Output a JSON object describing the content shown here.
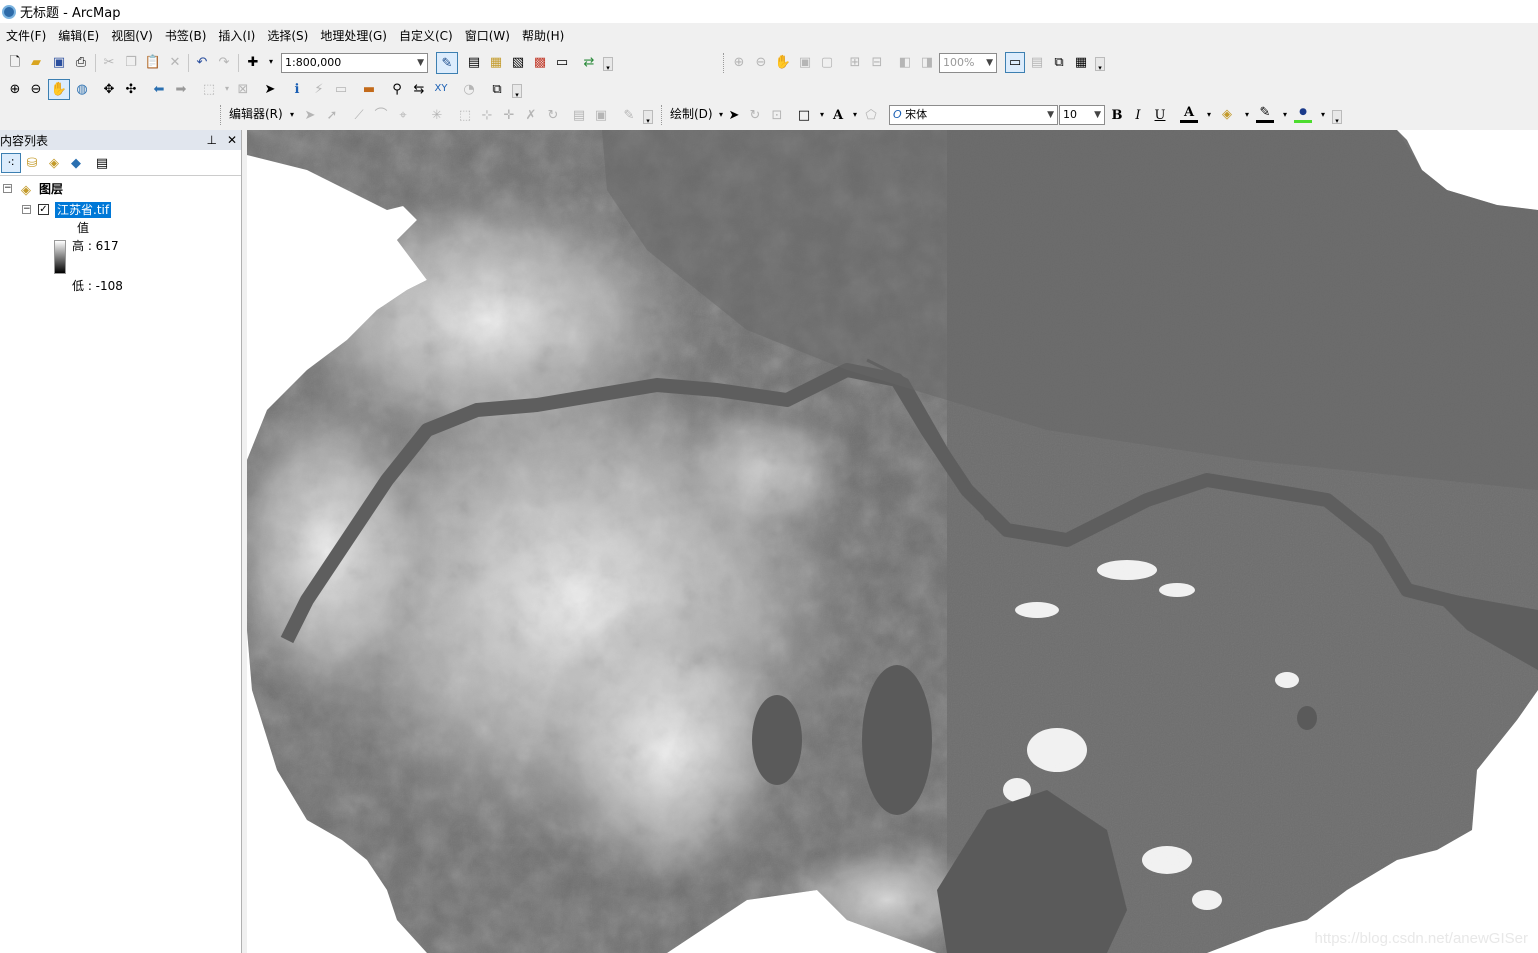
{
  "window": {
    "title": "无标题 - ArcMap"
  },
  "menu": [
    "文件(F)",
    "编辑(E)",
    "视图(V)",
    "书签(B)",
    "插入(I)",
    "选择(S)",
    "地理处理(G)",
    "自定义(C)",
    "窗口(W)",
    "帮助(H)"
  ],
  "standard_toolbar": {
    "scale_value": "1:800,000"
  },
  "layout_toolbar": {
    "zoom_percent": "100%"
  },
  "editor_toolbar": {
    "editor_label": "编辑器(R)"
  },
  "draw_toolbar": {
    "draw_label": "绘制(D)",
    "font_name": "宋体",
    "font_size": "10",
    "bold": "B",
    "italic": "I",
    "underline": "U",
    "text_color_glyph": "A"
  },
  "toc": {
    "title": "内容列表",
    "pin_glyph": "ⴲ",
    "close_glyph": "✕",
    "layers_root": "图层",
    "layer_name": "江苏省.tif",
    "legend_title": "值",
    "high_label": "高 : 617",
    "low_label": "低 : -108"
  },
  "map": {
    "watermark": "https://blog.csdn.net/anewGISer"
  }
}
